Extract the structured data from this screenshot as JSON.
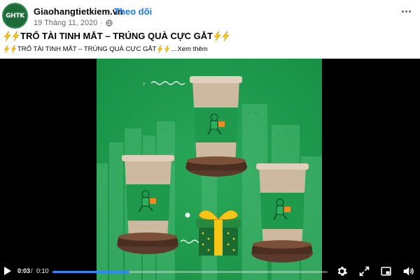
{
  "post": {
    "page_name": "Giaohangtietkiem.vn",
    "separator": "·",
    "follow_label": "Theo dõi",
    "date": "19 Tháng 11, 2020",
    "date_separator": "·",
    "avatar_text": "GHTK",
    "avatar_superscript": "®",
    "title": "TRỔ TÀI TINH MẮT – TRÚNG QUÀ CỰC GẮT",
    "subtitle": "TRỔ TÀI TINH MẮT – TRÚNG QUÀ CỰC GẮT",
    "subtitle_ellipsis": "...",
    "see_more_label": "Xem thêm"
  },
  "video": {
    "current_time": "0:03",
    "time_separator": "/",
    "total_time": "0:10",
    "progress": 0.28
  },
  "colors": {
    "link": "#1877f2",
    "brand_green": "#1f9a4c",
    "progress": "#2d88ff",
    "bolt": "#f5c518"
  },
  "icons": {
    "more": "more-horizontal-icon",
    "privacy": "globe-icon",
    "play": "play-icon",
    "volume": "volume-icon",
    "settings": "gear-icon",
    "pip": "picture-in-picture-icon",
    "fullscreen": "fullscreen-icon"
  }
}
